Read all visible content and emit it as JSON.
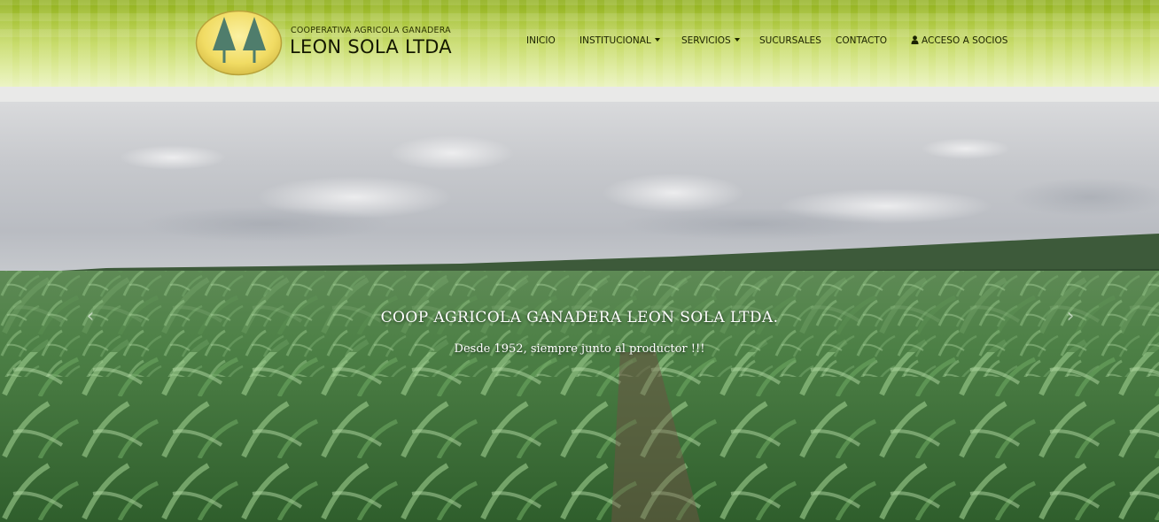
{
  "brand": {
    "subtitle": "COOPERATIVA AGRICOLA GANADERA",
    "name": "LEON SOLA LTDA",
    "logo_icon": "twin-trees-logo-icon",
    "colors": {
      "logo_fill": "#f3e27a",
      "trees": "#4b7a6b"
    }
  },
  "nav": {
    "items": [
      {
        "label": "INICIO"
      },
      {
        "label": "INSTITUCIONAL"
      },
      {
        "label": "SERVICIOS"
      },
      {
        "label": "SUCURSALES"
      },
      {
        "label": "CONTACTO"
      },
      {
        "label": "ACCESO A SOCIOS"
      }
    ]
  },
  "hero": {
    "title": "COOP AGRICOLA GANADERA LEON SOLA LTDA.",
    "subtitle": "Desde 1952, siempre junto al productor !!!",
    "prev_arrow": "‹",
    "next_arrow": "›"
  },
  "colors": {
    "header_top": "#8fae1a",
    "header_bottom": "#eaf3be",
    "text_dark": "#1b2200",
    "hero_text": "#ffffff"
  }
}
